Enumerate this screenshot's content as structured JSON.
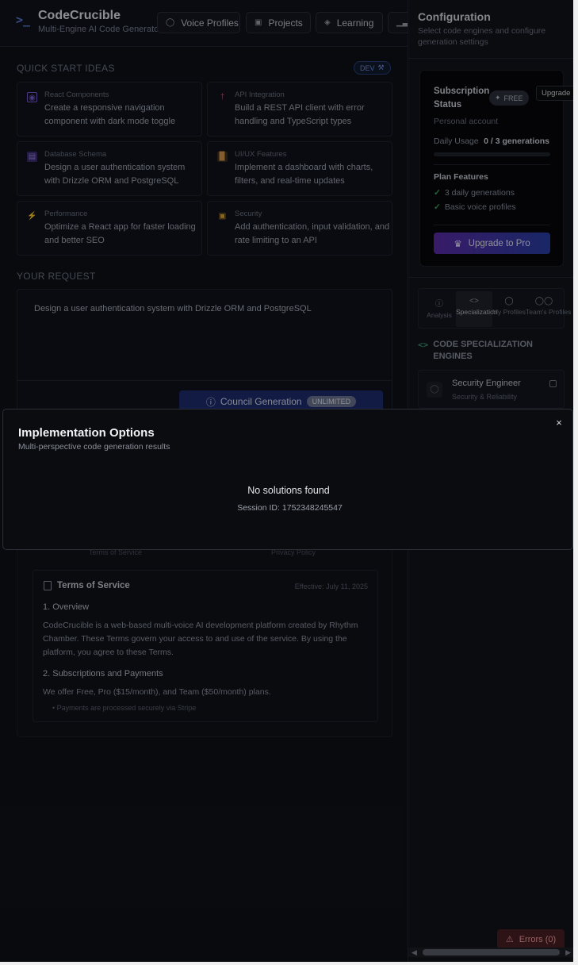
{
  "header": {
    "brand_icon": ">_",
    "title": "CodeCrucible",
    "subtitle": "Multi-Engine AI Code Generator",
    "nav": [
      {
        "label": "Voice Profiles",
        "icon": "user-icon"
      },
      {
        "label": "Projects",
        "icon": "folder-icon"
      },
      {
        "label": "Learning",
        "icon": "graduation-cap-icon"
      }
    ]
  },
  "quick_start": {
    "label": "QUICK START IDEAS",
    "dev_badge": "DEV",
    "cards": [
      {
        "category": "React Components",
        "description": "Create a responsive navigation component with dark mode toggle",
        "icon": "component-icon",
        "color": "#7b5cd6"
      },
      {
        "category": "API Integration",
        "description": "Build a REST API client with error handling and TypeScript types",
        "icon": "plug-icon",
        "color": "#b0566b"
      },
      {
        "category": "Database Schema",
        "description": "Design a user authentication system with Drizzle ORM and PostgreSQL",
        "icon": "database-icon",
        "color": "#6a4fb4"
      },
      {
        "category": "UI/UX Features",
        "description": "Implement a dashboard with charts, filters, and real-time updates",
        "icon": "bar-chart-icon",
        "color": "#c97a3a"
      },
      {
        "category": "Performance",
        "description": "Optimize a React app for faster loading and better SEO",
        "icon": "lightning-icon",
        "color": "#d66a2e"
      },
      {
        "category": "Security",
        "description": "Add authentication, input validation, and rate limiting to an API",
        "icon": "lock-icon",
        "color": "#d9a53a"
      }
    ]
  },
  "request": {
    "label": "YOUR REQUEST",
    "value": "Design a user authentication system with Drizzle ORM and PostgreSQL",
    "council_button": "Council Generation",
    "council_badge": "UNLIMITED"
  },
  "legal": {
    "tab_terms": "Terms of Service",
    "tab_privacy": "Privacy Policy",
    "title": "Terms of Service",
    "effective": "Effective: July 11, 2025",
    "s1_heading": "1. Overview",
    "s1_body": "CodeCrucible is a web-based multi-voice AI development platform created by Rhythm Chamber. These Terms govern your access to and use of the service. By using the platform, you agree to these Terms.",
    "s2_heading": "2. Subscriptions and Payments",
    "s2_body": "We offer Free, Pro ($15/month), and Team ($50/month) plans.",
    "s2_bullet": "• Payments are processed securely via Stripe"
  },
  "config": {
    "title": "Configuration",
    "subtitle": "Select code engines and configure generation settings",
    "subscription": {
      "title": "Subscription Status",
      "badge": "FREE",
      "upgrade_tooltip": "Upgrade",
      "account": "Personal account",
      "usage_label": "Daily Usage",
      "usage_value": "0 / 3 generations",
      "usage_fraction": 0,
      "plan_title": "Plan Features",
      "features": [
        "3 daily generations",
        "Basic voice profiles"
      ],
      "pro_button": "Upgrade to Pro"
    },
    "tabs": [
      {
        "label": "Analysis",
        "icon": "info-icon"
      },
      {
        "label": "Specialization",
        "icon": "code-icon"
      },
      {
        "label": "My Profiles",
        "icon": "user-icon"
      },
      {
        "label": "Team's Profiles",
        "icon": "users-icon"
      }
    ],
    "spec_heading": "CODE SPECIALIZATION ENGINES",
    "engine": {
      "name": "Security Engineer",
      "sub": "Security & Reliability"
    },
    "errors_button": "Errors (0)"
  },
  "modal": {
    "title": "Implementation Options",
    "subtitle": "Multi-perspective code generation results",
    "empty_text": "No solutions found",
    "session_label": "Session ID:",
    "session_id": "1752348245547",
    "close": "×"
  }
}
